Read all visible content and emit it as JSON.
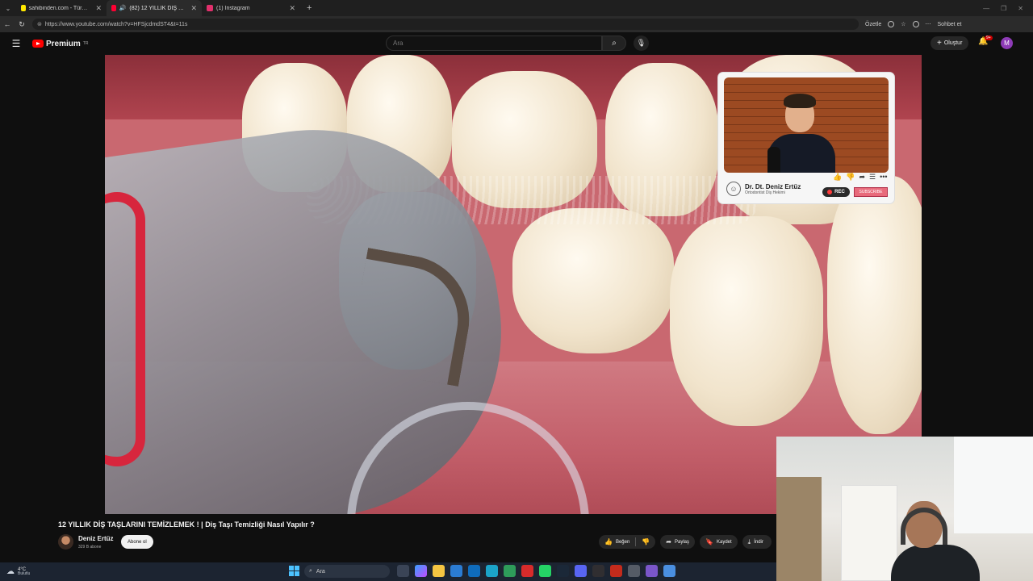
{
  "browser": {
    "tabs": [
      {
        "label": "sahibinden.com - Türkiye'nin Onli",
        "fav_color": "#ffe800",
        "active": false
      },
      {
        "label": "(82) 12 YILLIK DİŞ TAŞLARINI",
        "fav_color": "#ff0033",
        "active": true
      },
      {
        "label": "(1) Instagram",
        "fav_color": "#e1306c",
        "active": false
      }
    ],
    "new_tab": "+",
    "url": "https://www.youtube.com/watch?v=HFSjcdmdST4&t=11s",
    "summarize_label": "Özetle",
    "chat_label": "Sohbet et"
  },
  "youtube": {
    "logo_text": "Premium",
    "logo_sup": "TR",
    "search_placeholder": "Ara",
    "create_label": "Oluştur",
    "notif_badge": "9+",
    "avatar_letter": "M"
  },
  "embedded_card": {
    "channel_name": "Dr. Dt. Deniz Ertüz",
    "channel_sub": "Ortodontist Diş Hekimi",
    "rec_label": "REC",
    "subscribe_label": "SUBSCRIBE"
  },
  "video": {
    "title": "12 YILLIK DİŞ TAŞLARINI TEMİZLEMEK ! | Diş Taşı Temizliği Nasıl Yapılır ?",
    "channel_name": "Deniz Ertüz",
    "subscriber_count": "329 B abone",
    "subscribe_label": "Abone ol",
    "actions": {
      "like": "Beğen",
      "share": "Paylaş",
      "save": "Kaydet",
      "download": "İndir"
    }
  },
  "taskbar": {
    "temp": "4°C",
    "condition": "Bulutlu",
    "search_label": "Ara"
  }
}
